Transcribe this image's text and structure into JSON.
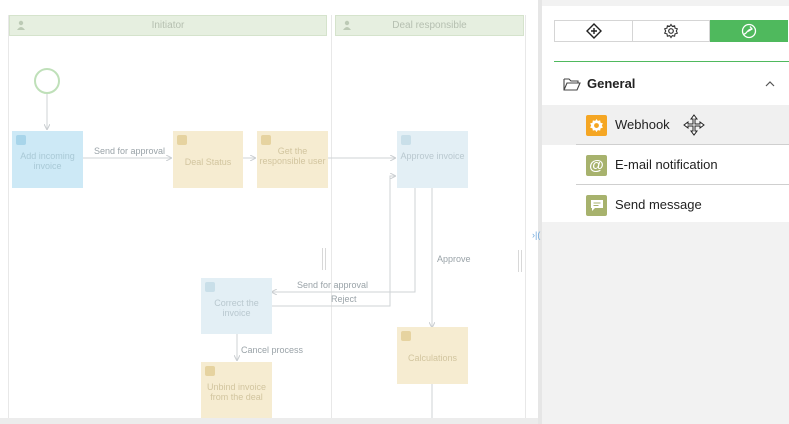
{
  "lanes": {
    "initiator": "Initiator",
    "deal_responsible": "Deal responsible"
  },
  "tasks": {
    "add_incoming_invoice": "Add incoming invoice",
    "deal_status": "Deal Status",
    "get_responsible_user": "Get the responsible user",
    "approve_invoice": "Approve invoice",
    "correct_invoice": "Correct the invoice",
    "calculations": "Calculations",
    "unbind_invoice": "Unbind invoice from the deal"
  },
  "connections": {
    "send_for_approval_1": "Send for approval",
    "send_for_approval_2": "Send for approval",
    "reject": "Reject",
    "approve": "Approve",
    "cancel_process": "Cancel process"
  },
  "panel": {
    "tabs": [
      "add-block",
      "settings",
      "logic"
    ],
    "active_tab": "logic",
    "group": {
      "label": "General",
      "expanded": true,
      "items": [
        {
          "label": "Webhook",
          "icon": "gear-icon",
          "color": "#f5a623",
          "hovered": true
        },
        {
          "label": "E-mail notification",
          "icon": "at-sign-icon",
          "color": "#a7b26d"
        },
        {
          "label": "Send message",
          "icon": "chat-icon",
          "color": "#a7b26d"
        }
      ]
    }
  },
  "colors": {
    "accent_green": "#4fb95d",
    "lane_header": "#e6efe0",
    "task_blue": "#cde9f6",
    "task_yellow": "#f6ecd1"
  }
}
